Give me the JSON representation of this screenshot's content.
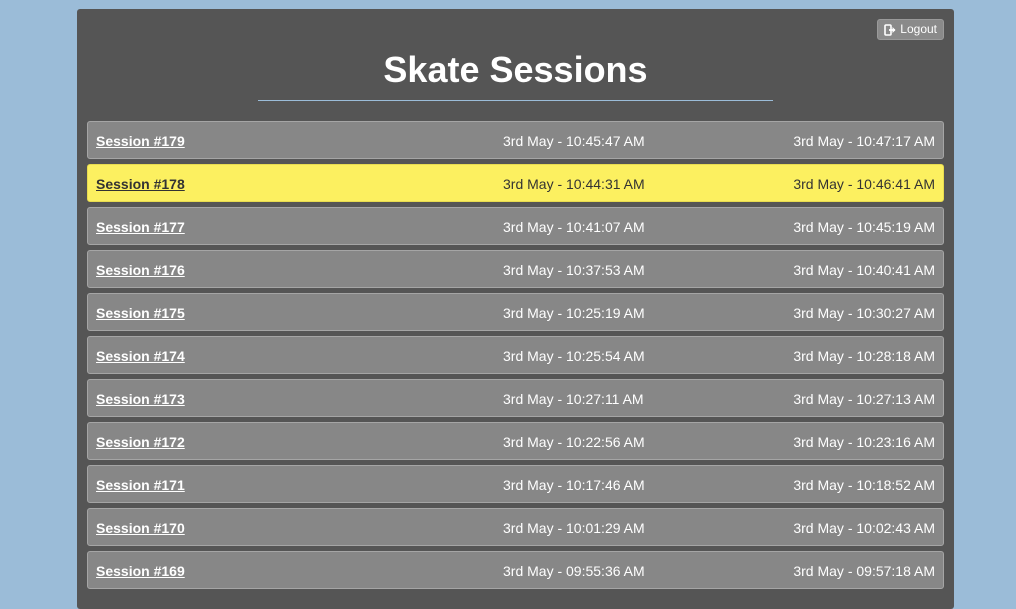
{
  "header": {
    "title": "Skate Sessions",
    "logout_label": "Logout"
  },
  "colors": {
    "background": "#9bbcd8",
    "panel": "#555555",
    "row": "#878787",
    "highlight": "#fcf060"
  },
  "sessions": [
    {
      "name": "Session #179",
      "start": "3rd May - 10:45:47 AM",
      "end": "3rd May - 10:47:17 AM",
      "highlighted": false
    },
    {
      "name": "Session #178",
      "start": "3rd May - 10:44:31 AM",
      "end": "3rd May - 10:46:41 AM",
      "highlighted": true
    },
    {
      "name": "Session #177",
      "start": "3rd May - 10:41:07 AM",
      "end": "3rd May - 10:45:19 AM",
      "highlighted": false
    },
    {
      "name": "Session #176",
      "start": "3rd May - 10:37:53 AM",
      "end": "3rd May - 10:40:41 AM",
      "highlighted": false
    },
    {
      "name": "Session #175",
      "start": "3rd May - 10:25:19 AM",
      "end": "3rd May - 10:30:27 AM",
      "highlighted": false
    },
    {
      "name": "Session #174",
      "start": "3rd May - 10:25:54 AM",
      "end": "3rd May - 10:28:18 AM",
      "highlighted": false
    },
    {
      "name": "Session #173",
      "start": "3rd May - 10:27:11 AM",
      "end": "3rd May - 10:27:13 AM",
      "highlighted": false
    },
    {
      "name": "Session #172",
      "start": "3rd May - 10:22:56 AM",
      "end": "3rd May - 10:23:16 AM",
      "highlighted": false
    },
    {
      "name": "Session #171",
      "start": "3rd May - 10:17:46 AM",
      "end": "3rd May - 10:18:52 AM",
      "highlighted": false
    },
    {
      "name": "Session #170",
      "start": "3rd May - 10:01:29 AM",
      "end": "3rd May - 10:02:43 AM",
      "highlighted": false
    },
    {
      "name": "Session #169",
      "start": "3rd May - 09:55:36 AM",
      "end": "3rd May - 09:57:18 AM",
      "highlighted": false
    }
  ]
}
